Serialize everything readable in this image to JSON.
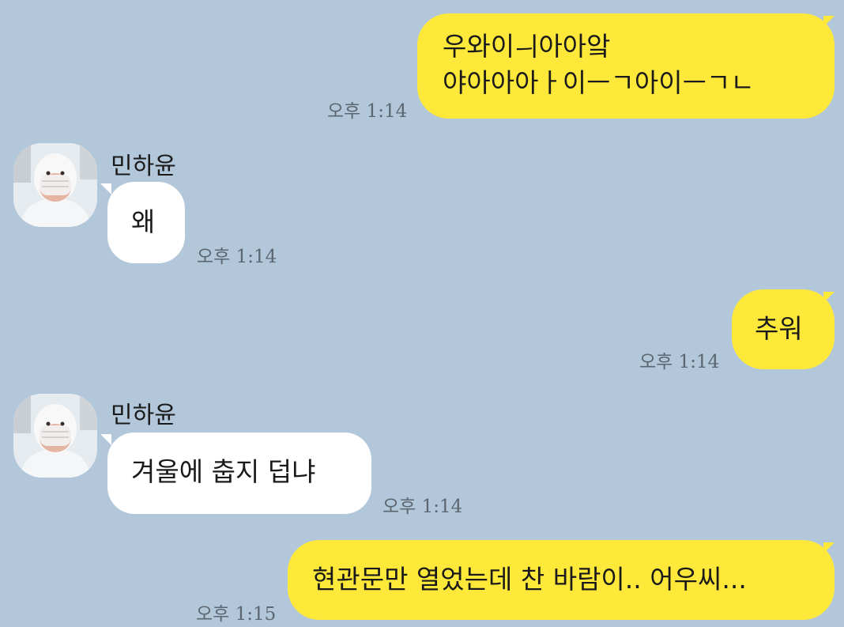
{
  "colors": {
    "background": "#b2c7da",
    "my_bubble": "#fee93a",
    "their_bubble": "#ffffff",
    "timestamp": "#5b6670"
  },
  "messages": [
    {
      "from": "me",
      "lines": [
        "우와이ㅢ아아앜",
        "야아아아ㅏ이ㅡㄱ아이ㅡㄱㄴ"
      ],
      "time": "오후 1:14"
    },
    {
      "from": "them",
      "sender": "민하윤",
      "avatar_icon": "profile-photo-person-in-mask",
      "lines": [
        "왜"
      ],
      "time": "오후 1:14"
    },
    {
      "from": "me",
      "lines": [
        "추워"
      ],
      "time": "오후 1:14"
    },
    {
      "from": "them",
      "sender": "민하윤",
      "avatar_icon": "profile-photo-person-in-mask",
      "lines": [
        "겨울에 춥지 덥냐"
      ],
      "time": "오후 1:14"
    },
    {
      "from": "me",
      "lines": [
        "현관문만 열었는데 찬 바람이.. 어우씨..."
      ],
      "time": "오후 1:15"
    }
  ]
}
